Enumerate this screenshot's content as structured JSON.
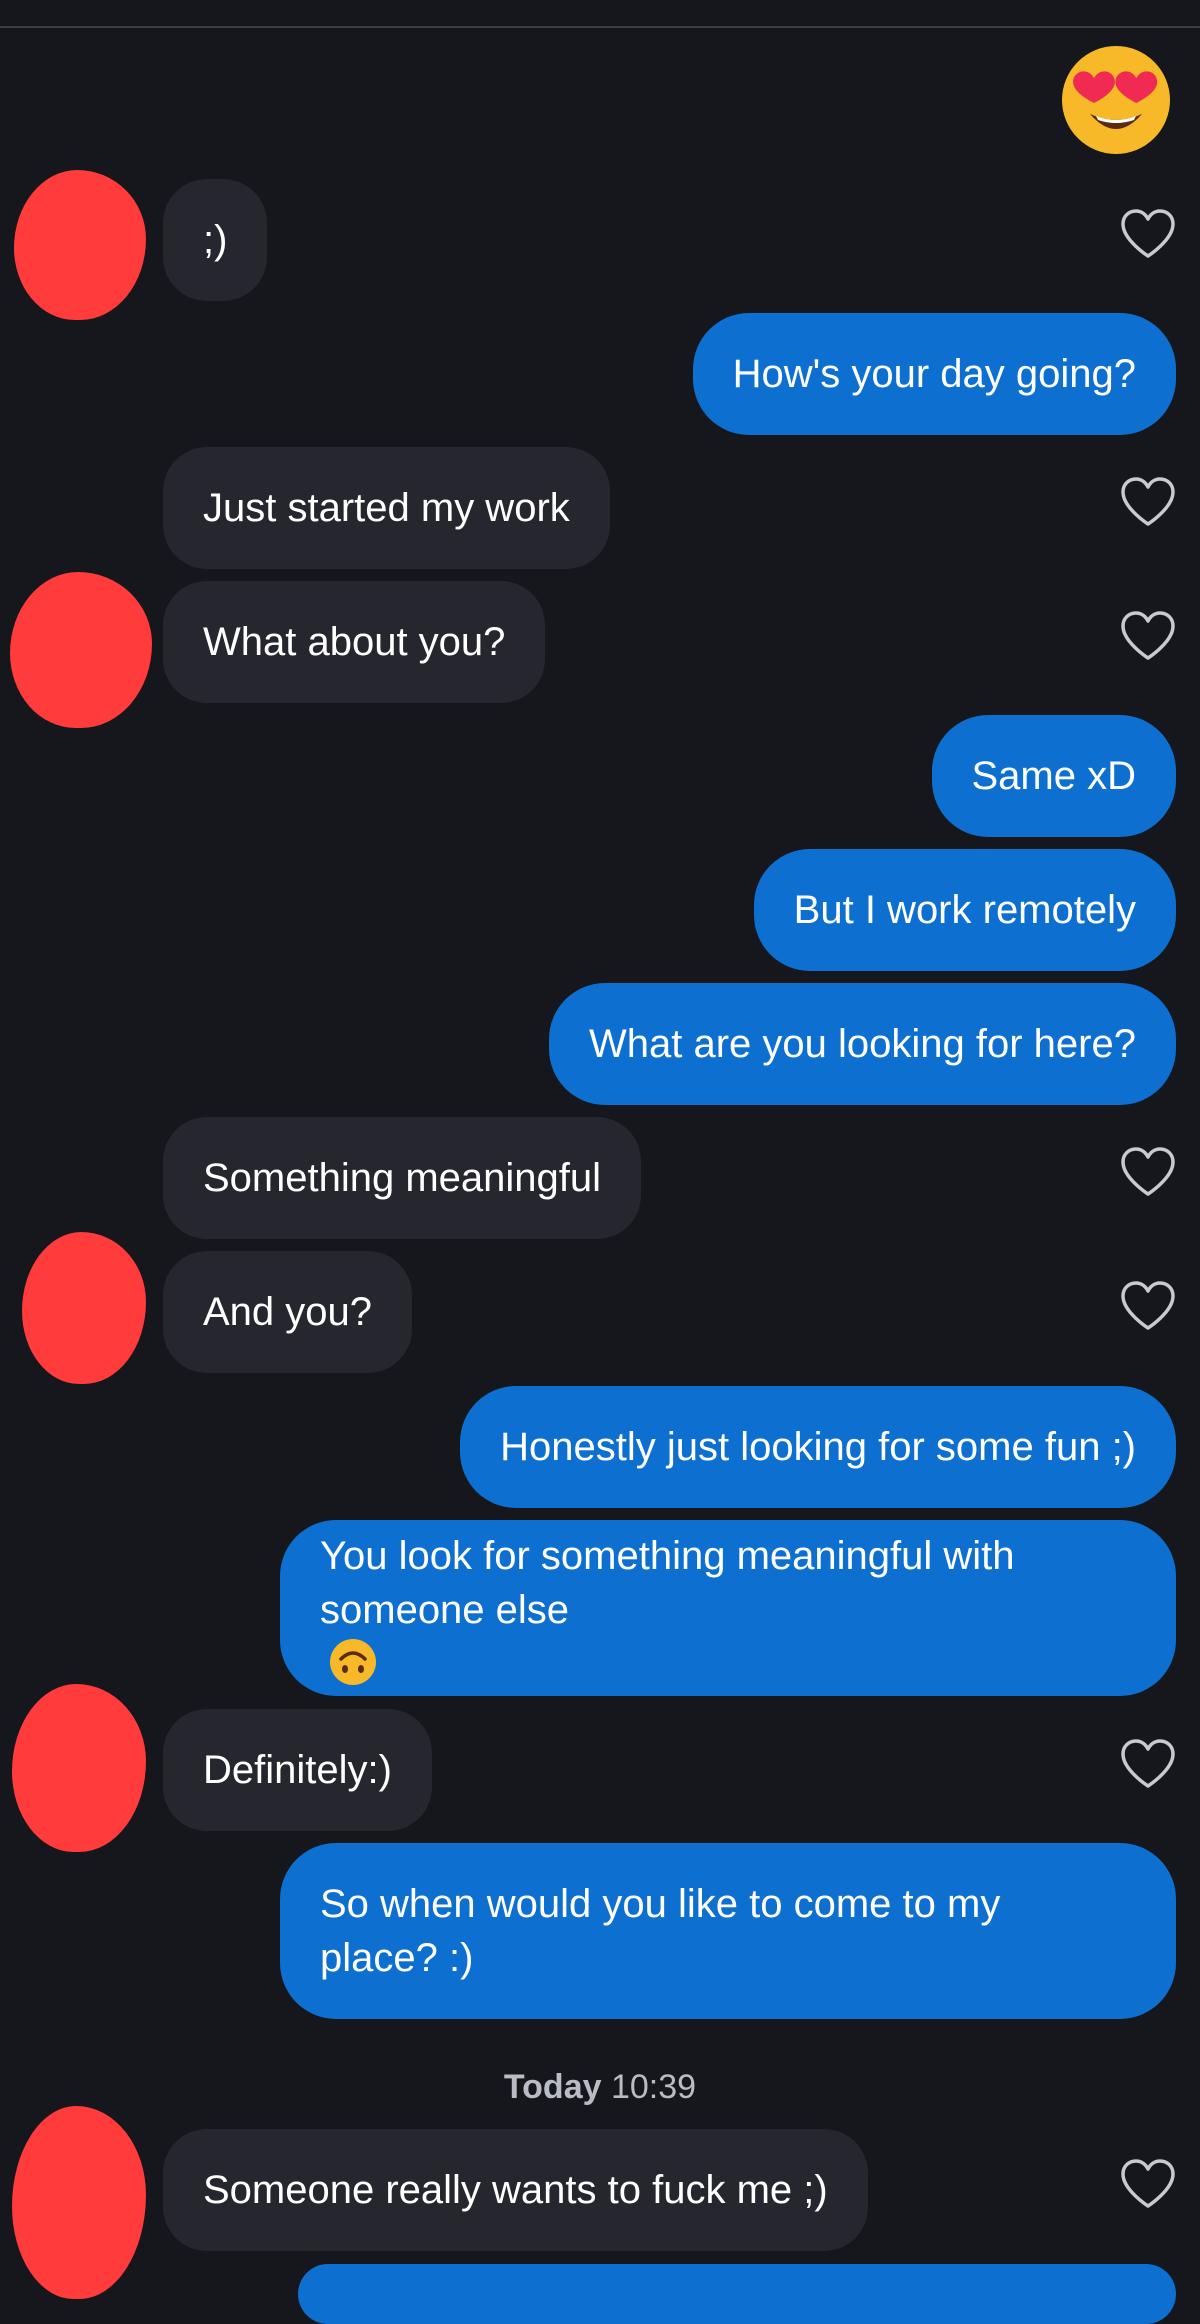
{
  "thread": {
    "reaction_emoji": "heart-eyes-emoji",
    "timestamp_day": "Today",
    "timestamp_time": "10:39",
    "messages": [
      {
        "from": "them",
        "text": ";)"
      },
      {
        "from": "me",
        "text": "How's your day going?"
      },
      {
        "from": "them",
        "text": "Just started my work"
      },
      {
        "from": "them",
        "text": "What about you?"
      },
      {
        "from": "me",
        "text": "Same xD"
      },
      {
        "from": "me",
        "text": "But I work remotely"
      },
      {
        "from": "me",
        "text": "What are you looking for here?"
      },
      {
        "from": "them",
        "text": "Something meaningful"
      },
      {
        "from": "them",
        "text": "And you?"
      },
      {
        "from": "me",
        "text": "Honestly just looking for some fun ;)"
      },
      {
        "from": "me",
        "text_line1": "You look for something meaningful with",
        "text_line2": "someone else",
        "emoji": "upside-down-face-emoji"
      },
      {
        "from": "them",
        "text": "Definitely:)"
      },
      {
        "from": "me",
        "text_line1": "So when would you like to come to my",
        "text_line2": "place? :)"
      },
      {
        "from": "them",
        "text": "Someone really wants to fuck me ;)"
      }
    ]
  },
  "colors": {
    "background": "#15171c",
    "incoming_bubble": "#26272e",
    "outgoing_bubble": "#0d6fd0",
    "redaction": "#ff3b3b",
    "heart_outline": "#c8cacf"
  },
  "icons": {
    "like": "heart-outline-icon"
  }
}
